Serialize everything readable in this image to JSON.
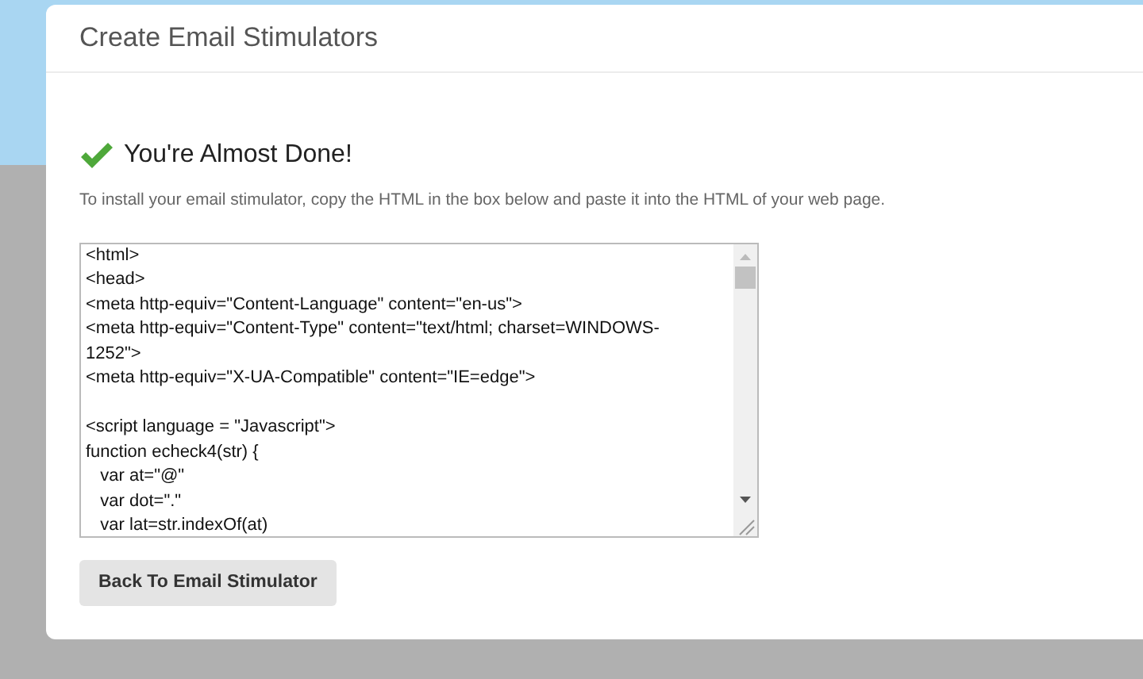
{
  "panel": {
    "title": "Create Email Stimulators"
  },
  "message": {
    "heading": "You're Almost Done!",
    "instructions": "To install your email stimulator, copy the HTML in the box below and paste it into the HTML of your web page."
  },
  "code_box": {
    "value": "<html>\n<head>\n<meta http-equiv=\"Content-Language\" content=\"en-us\">\n<meta http-equiv=\"Content-Type\" content=\"text/html; charset=WINDOWS-\n1252\">\n<meta http-equiv=\"X-UA-Compatible\" content=\"IE=edge\">\n\n<script language = \"Javascript\">\nfunction echeck4(str) {\n   var at=\"@\"\n   var dot=\".\"\n   var lat=str.indexOf(at)"
  },
  "buttons": [
    {
      "label": "Back To Email Stimulator"
    }
  ]
}
